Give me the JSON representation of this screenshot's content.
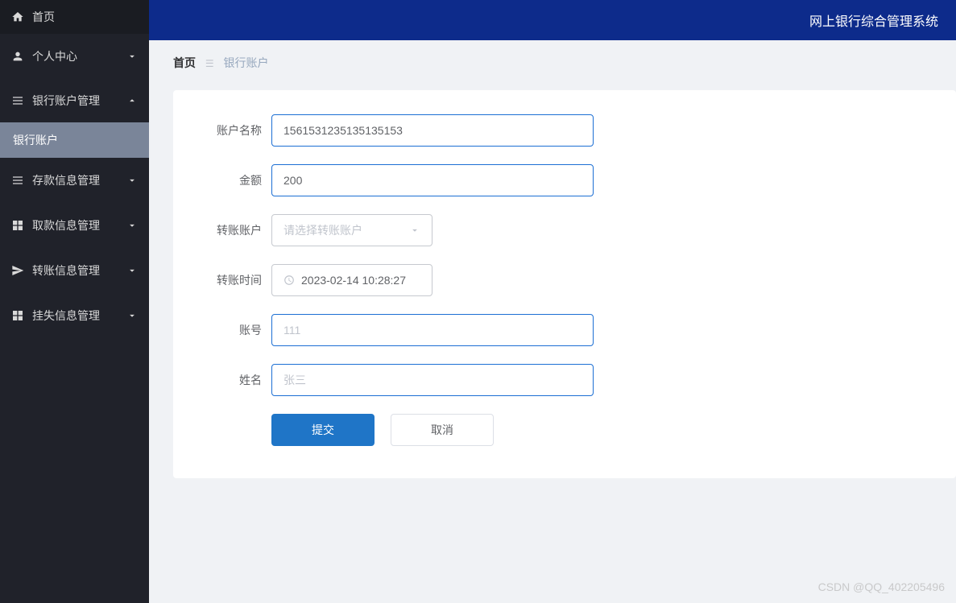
{
  "sidebar": {
    "home": "首页",
    "items": [
      {
        "label": "个人中心"
      },
      {
        "label": "银行账户管理"
      },
      {
        "label": "存款信息管理"
      },
      {
        "label": "取款信息管理"
      },
      {
        "label": "转账信息管理"
      },
      {
        "label": "挂失信息管理"
      }
    ],
    "subitem": "银行账户"
  },
  "topbar": {
    "title": "网上银行综合管理系统"
  },
  "breadcrumb": {
    "home": "首页",
    "current": "银行账户"
  },
  "form": {
    "account_name_label": "账户名称",
    "account_name_value": "1561531235135135153",
    "amount_label": "金额",
    "amount_value": "200",
    "transfer_account_label": "转账账户",
    "transfer_account_placeholder": "请选择转账账户",
    "transfer_time_label": "转账时间",
    "transfer_time_value": "2023-02-14 10:28:27",
    "account_no_label": "账号",
    "account_no_value": "111",
    "name_label": "姓名",
    "name_value": "张三",
    "submit": "提交",
    "cancel": "取消"
  },
  "watermark": "CSDN @QQ_402205496"
}
